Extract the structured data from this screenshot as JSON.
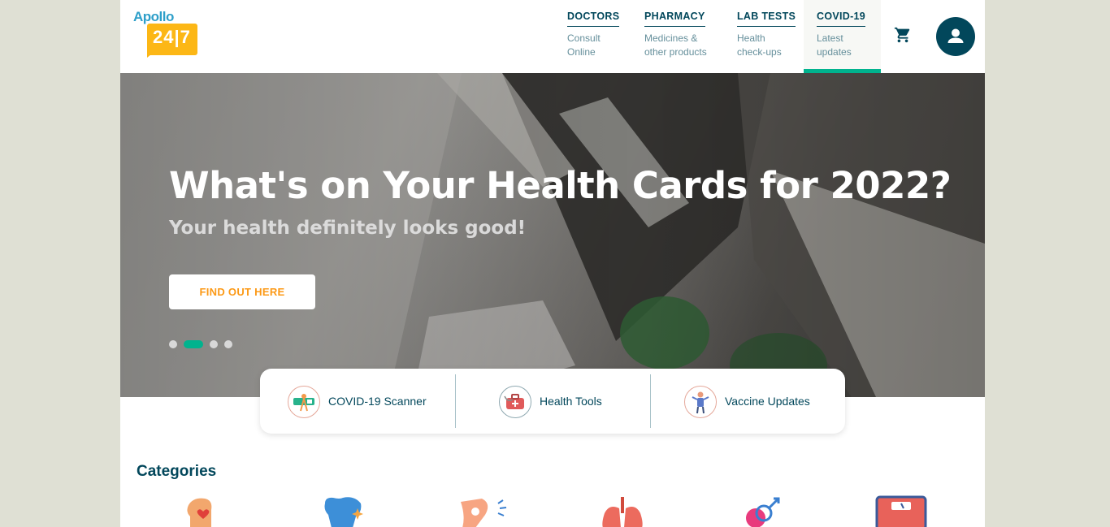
{
  "header": {
    "logo": {
      "brand": "Apollo",
      "number": "24|7"
    },
    "nav": [
      {
        "title": "DOCTORS",
        "subtitle": "Consult\nOnline"
      },
      {
        "title": "PHARMACY",
        "subtitle": "Medicines &\nother products"
      },
      {
        "title": "LAB TESTS",
        "subtitle": "Health\ncheck-ups"
      },
      {
        "title": "COVID-19",
        "subtitle": "Latest\nupdates"
      }
    ]
  },
  "hero": {
    "title": "What's on Your Health Cards for 2022?",
    "subtitle": "Your health definitely looks good!",
    "button_label": "FIND OUT HERE",
    "slide_count": 4,
    "active_slide": 2
  },
  "quick_links": [
    {
      "label": "COVID-19 Scanner",
      "icon": "covid-scanner-icon"
    },
    {
      "label": "Health Tools",
      "icon": "health-tools-icon"
    },
    {
      "label": "Vaccine Updates",
      "icon": "vaccine-updates-icon"
    }
  ],
  "categories": {
    "title": "Categories",
    "icons": [
      "mental-health-icon",
      "dental-icon",
      "bones-joints-icon",
      "lungs-icon",
      "sexual-health-icon",
      "weight-scale-icon"
    ]
  },
  "colors": {
    "brand_dark": "#02475b",
    "accent_green": "#00b38e",
    "accent_orange": "#fc9916",
    "logo_yellow": "#fcb716"
  }
}
